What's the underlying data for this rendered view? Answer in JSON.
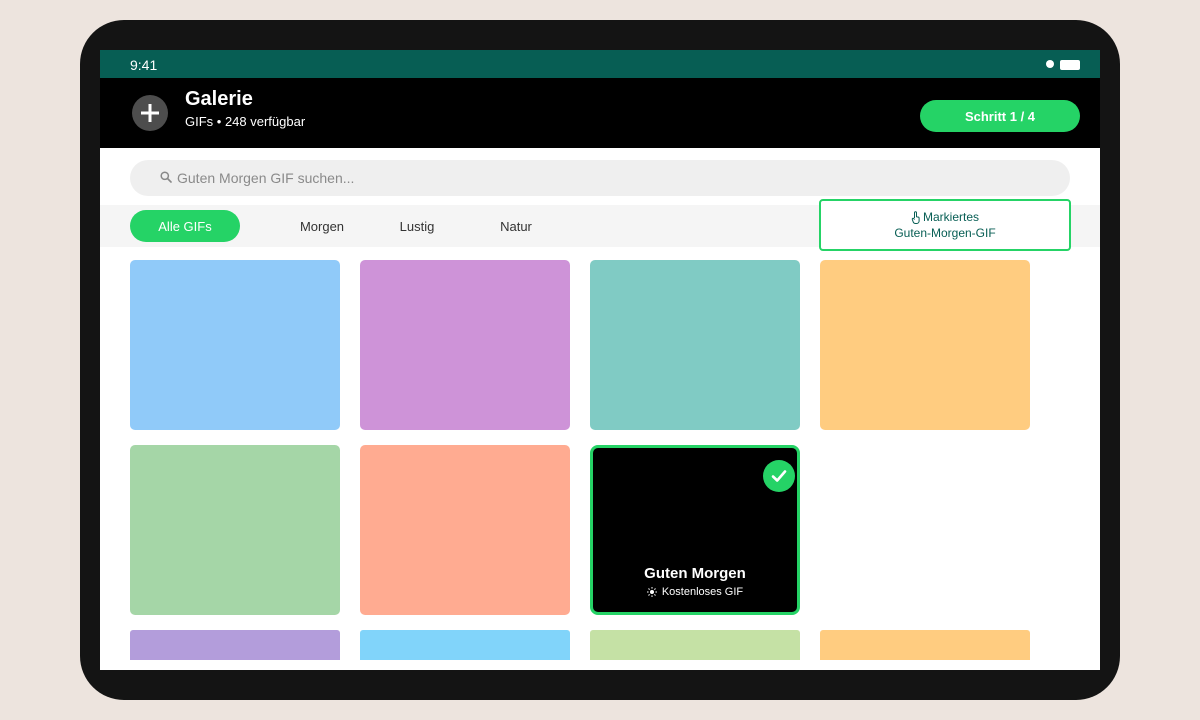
{
  "status_bar": {
    "time": "9:41"
  },
  "header": {
    "title": "Galerie",
    "subtitle": "GIFs • 248 verfügbar",
    "step_label": "Schritt 1 / 4"
  },
  "search": {
    "placeholder": "Guten Morgen GIF suchen..."
  },
  "filters": [
    "Alle GIFs",
    "Morgen",
    "Lustig",
    "Natur"
  ],
  "active_filter": "Alle GIFs",
  "callout": {
    "icon": "hand-pointer-icon",
    "line1": "Markiertes",
    "line2": "Guten-Morgen-GIF"
  },
  "gallery": {
    "tile_colors": [
      "#90caf9",
      "#ce93d8",
      "#80cbc4",
      "#ffcc80",
      "#a5d6a7",
      "#ffab91",
      "#b39ddb",
      "#81d4fa",
      "#c5e1a5",
      "#ffcc80"
    ],
    "selected": {
      "title": "Guten Morgen",
      "badge_icon": "sun-icon",
      "subtitle": "Kostenloses GIF",
      "checked": true
    }
  },
  "colors": {
    "accent": "#25d366",
    "status_bar": "#075e54",
    "header": "#000000"
  }
}
